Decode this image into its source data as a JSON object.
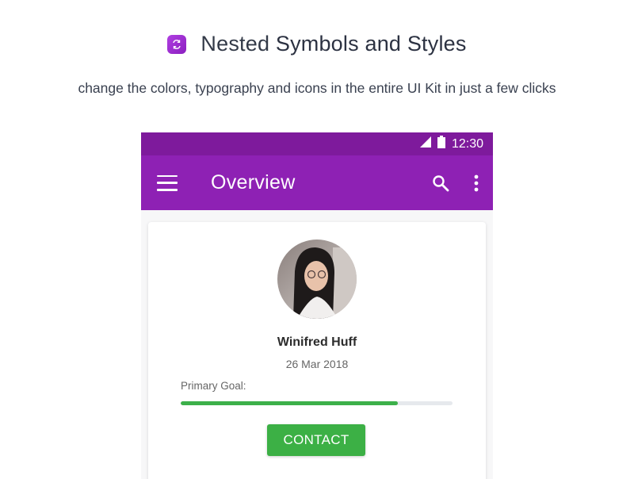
{
  "header": {
    "title_light": "Nested ",
    "title_strong": "Symbols and Styles",
    "subtitle": "change the colors, typography and icons in the entire UI Kit in just a few clicks",
    "badge_icon": "sync-icon"
  },
  "status_bar": {
    "time": "12:30",
    "icons": [
      "signal-icon",
      "battery-icon"
    ]
  },
  "app_bar": {
    "title": "Overview",
    "icons": [
      "menu-icon",
      "search-icon",
      "more-vert-icon"
    ]
  },
  "profile": {
    "name": "Winifred Huff",
    "date": "26 Mar 2018",
    "goal_label": "Primary Goal:",
    "goal_progress_percent": 80,
    "contact_label": "CONTACT"
  },
  "colors": {
    "status_bar": "#7e1a9c",
    "app_bar": "#8e21b4",
    "accent_green": "#3cb045",
    "badge": "#a233d6"
  }
}
